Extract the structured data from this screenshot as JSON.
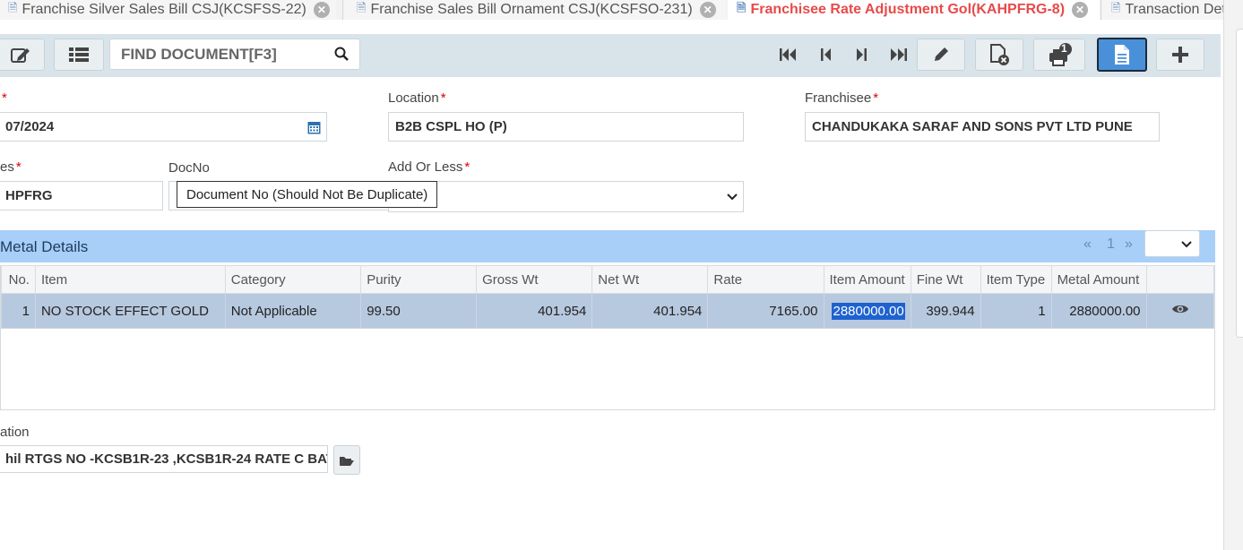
{
  "tabs": [
    {
      "label": "Franchise Silver Sales Bill CSJ(KCSFSS-22)",
      "closable": true,
      "active": false
    },
    {
      "label": "Franchise Sales Bill Ornament CSJ(KCSFSO-231)",
      "closable": true,
      "active": false
    },
    {
      "label": "Franchisee Rate Adjustment Gol(KAHPFRG-8)",
      "closable": true,
      "active": true
    },
    {
      "label": "Transaction Det",
      "closable": false,
      "active": false
    }
  ],
  "toolbar": {
    "search_placeholder": "FIND DOCUMENT[F3]",
    "notification_count": "1",
    "icons": [
      "edit-icon",
      "list-icon",
      "search-icon",
      "first-record-icon",
      "previous-record-icon",
      "next-record-icon",
      "last-record-icon",
      "pencil-icon",
      "cancel-document-icon",
      "print-icon",
      "document-icon",
      "plus-icon"
    ]
  },
  "form": {
    "date_value": "07/2024",
    "location_label": "Location",
    "location_value": "B2B CSPL HO (P)",
    "franchisee_label": "Franchisee",
    "franchisee_value": "CHANDUKAKA SARAF AND SONS PVT LTD PUNE",
    "series_label": "es",
    "series_value": "HPFRG",
    "docno_label": "DocNo",
    "docno_tooltip": "Document No (Should Not Be Duplicate)",
    "add_or_less_label": "Add Or Less",
    "add_or_less_value": "",
    "narration_label": "ation",
    "narration_value": "hil RTGS NO -KCSB1R-23 ,KCSB1R-24 RATE C BAT"
  },
  "metal_details": {
    "title": "Metal Details",
    "page": "1",
    "prev": "«",
    "next": "»",
    "columns": [
      "No.",
      "Item",
      "Category",
      "Purity",
      "Gross Wt",
      "Net Wt",
      "Rate",
      "Item Amount",
      "Fine Wt",
      "Item Type",
      "Metal Amount",
      ""
    ],
    "rows": [
      {
        "no": "1",
        "item": "NO STOCK EFFECT GOLD",
        "category": "Not Applicable",
        "purity": "99.50",
        "gross_wt": "401.954",
        "net_wt": "401.954",
        "rate": "7165.00",
        "item_amount": "2880000.00",
        "fine_wt": "399.944",
        "item_type": "1",
        "metal_amount": "2880000.00"
      }
    ]
  },
  "colors": {
    "active_tab": "#e84a4a",
    "toolbar_bg": "#d9e4ea",
    "grid_header": "#a7cff7",
    "row_bg": "#b7c9df",
    "selection": "#1f62cf",
    "primary_button": "#4a90d9"
  }
}
